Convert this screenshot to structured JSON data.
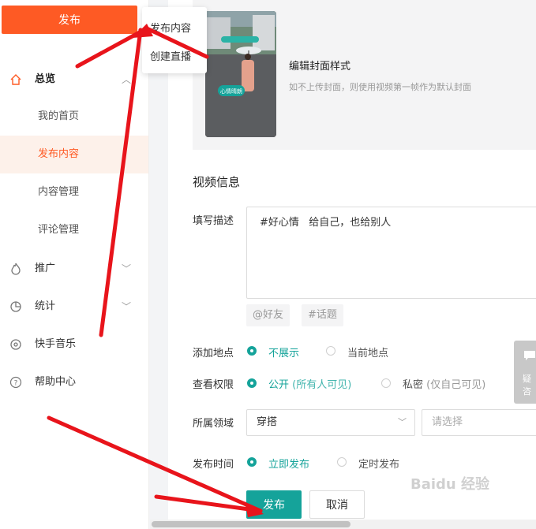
{
  "sidebar": {
    "publish_label": "发布",
    "groups": [
      {
        "label": "总览",
        "icon": "home-icon"
      },
      {
        "label": "推广",
        "icon": "flame-icon"
      },
      {
        "label": "统计",
        "icon": "pie-chart-icon"
      },
      {
        "label": "快手音乐",
        "icon": "music-disc-icon"
      },
      {
        "label": "帮助中心",
        "icon": "help-circle-icon"
      }
    ],
    "sub_items": [
      "我的首页",
      "发布内容",
      "内容管理",
      "评论管理"
    ],
    "active_sub": "发布内容"
  },
  "popup": {
    "items": [
      "发布内容",
      "创建直播"
    ]
  },
  "cover": {
    "title": "编辑封面样式",
    "hint": "如不上传封面，则使用视频第一帧作为默认封面",
    "thumb_caption": "心情晴朗"
  },
  "video_info": {
    "section_title": "视频信息",
    "desc_label": "填写描述",
    "desc_text": "#好心情   给自己，也给别人",
    "tag_buttons": [
      "@好友",
      "#话题"
    ],
    "location_label": "添加地点",
    "location_options": [
      {
        "label": "不展示",
        "selected": true
      },
      {
        "label": "当前地点",
        "selected": false
      }
    ],
    "permission_label": "查看权限",
    "permission_options": [
      {
        "label": "公开",
        "sub": "(所有人可见)",
        "selected": true
      },
      {
        "label": "私密",
        "sub": "(仅自己可见)",
        "selected": false
      }
    ],
    "domain_label": "所属领域",
    "domain_value": "穿搭",
    "domain_placeholder": "请选择",
    "time_label": "发布时间",
    "time_options": [
      {
        "label": "立即发布",
        "selected": true
      },
      {
        "label": "定时发布",
        "selected": false
      }
    ]
  },
  "actions": {
    "publish": "发布",
    "cancel": "取消"
  },
  "float_help": {
    "line1": "疑",
    "line2": "咨"
  },
  "watermark": "Baidu 经验",
  "colors": {
    "brand_orange": "#fe5a24",
    "accent_teal": "#15a39a",
    "annotation_red": "#e8141b"
  }
}
